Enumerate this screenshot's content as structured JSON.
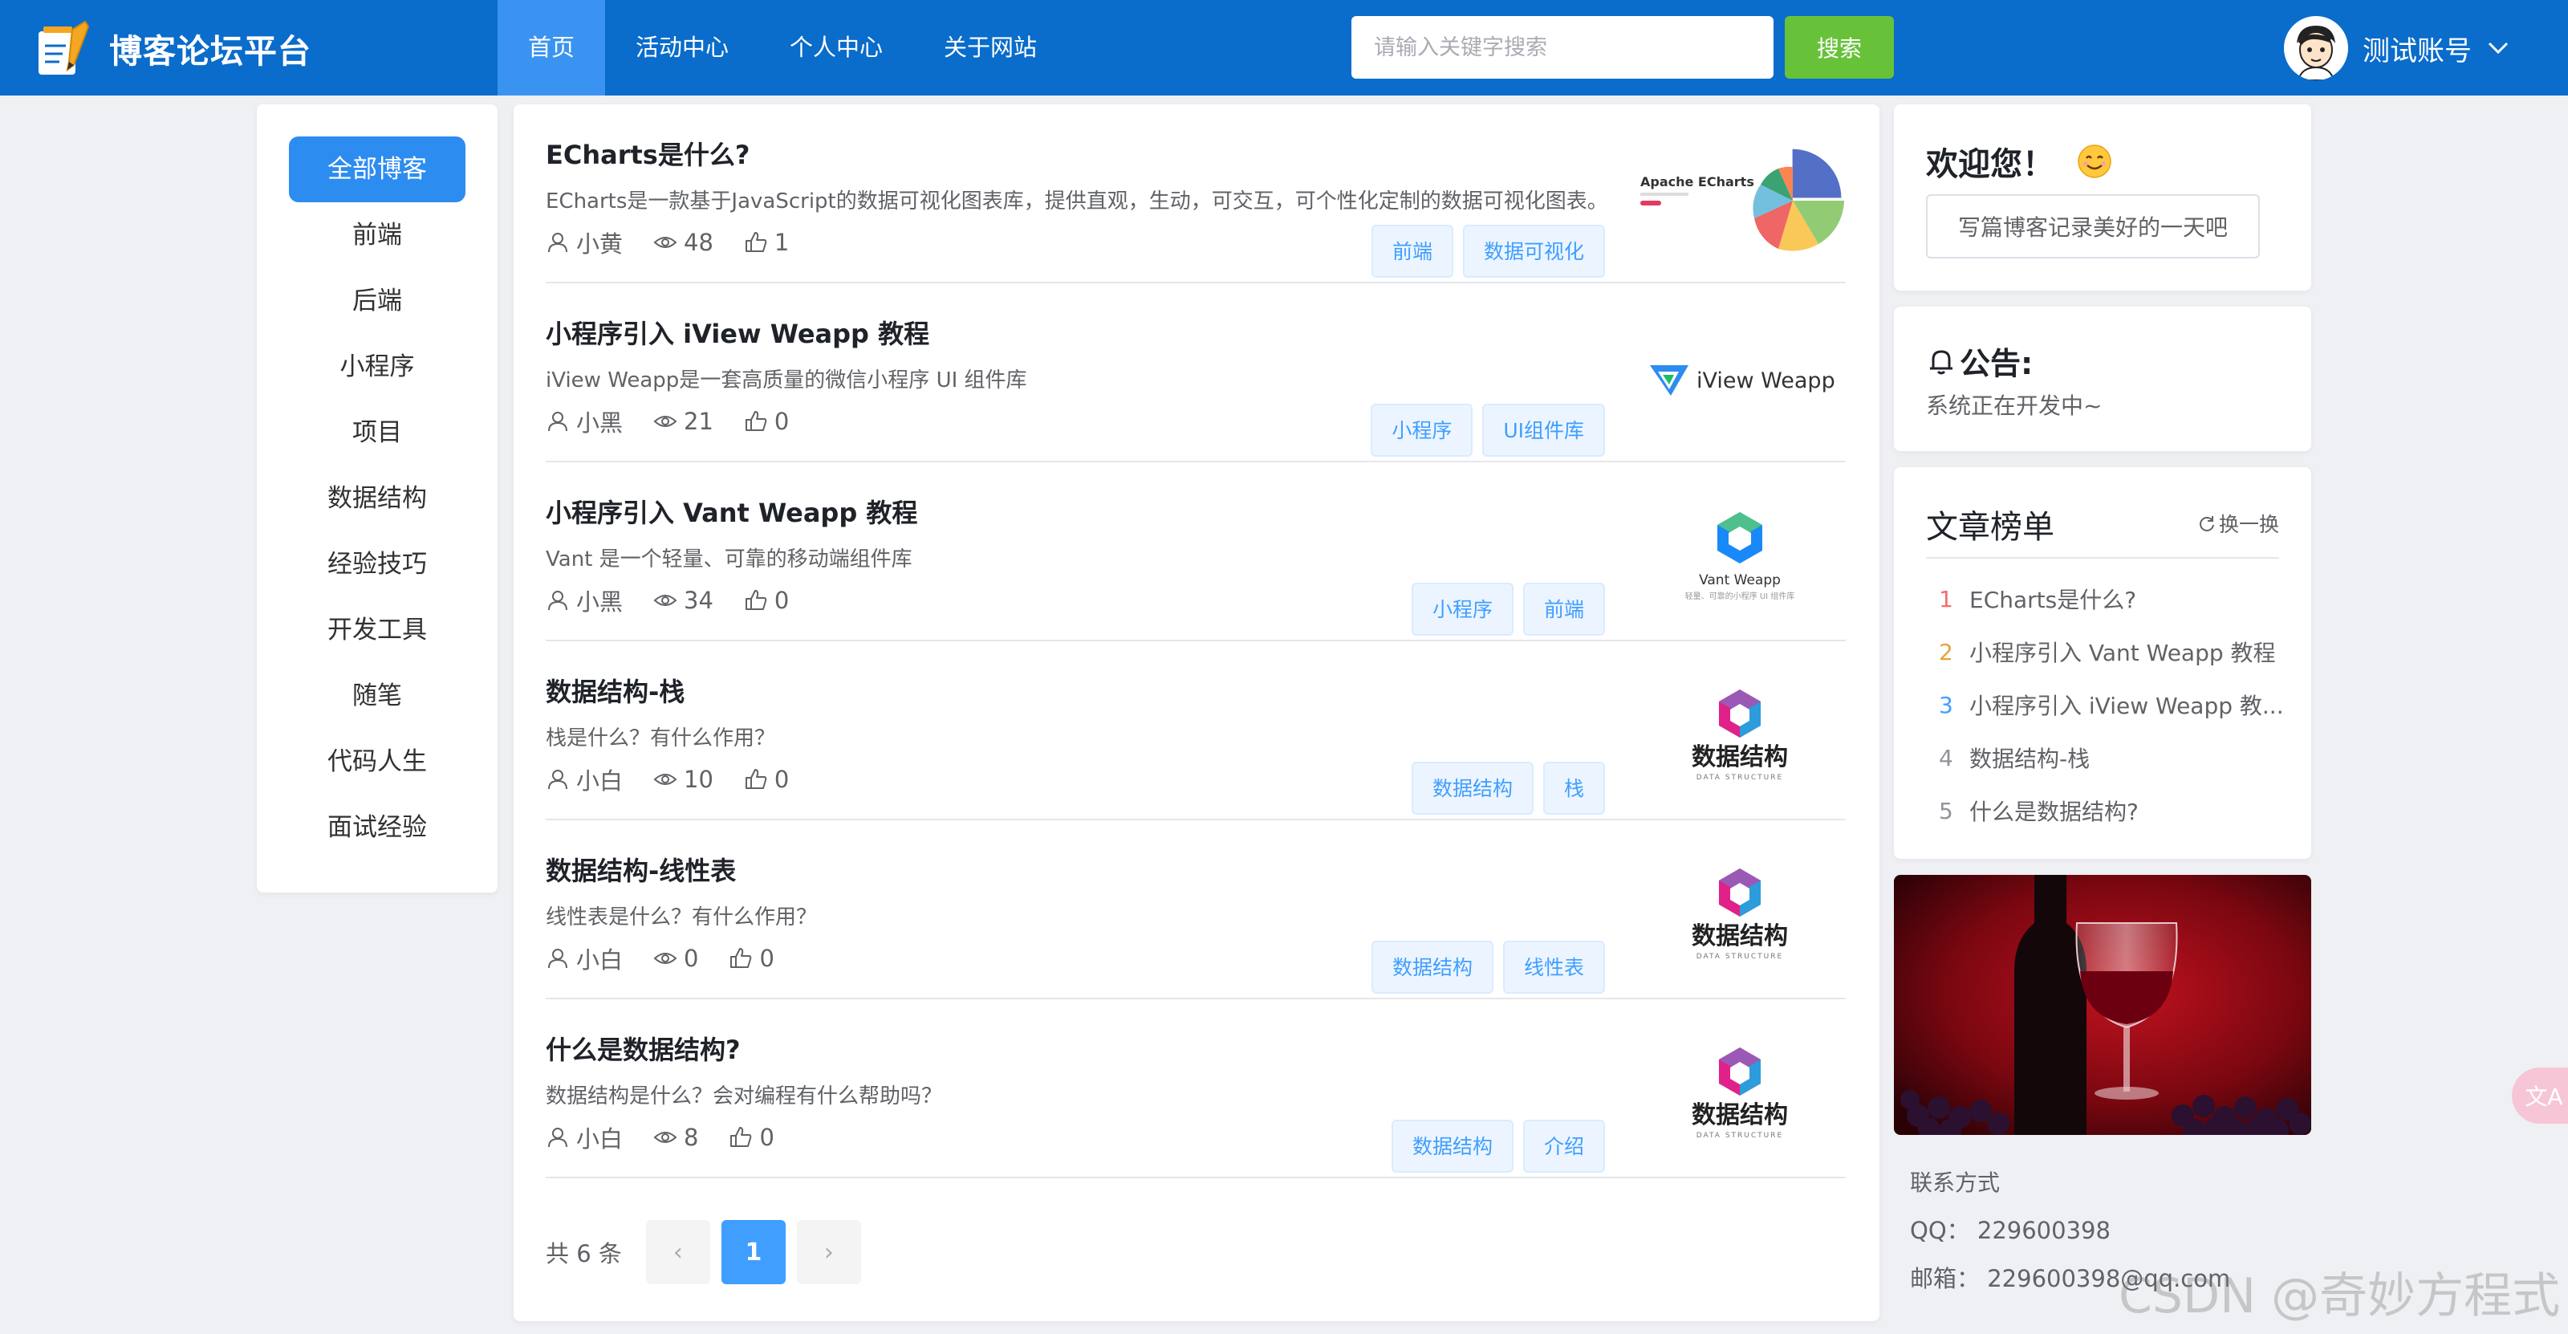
{
  "header": {
    "site_name": "博客论坛平台",
    "nav": [
      "首页",
      "活动中心",
      "个人中心",
      "关于网站"
    ],
    "search_placeholder": "请输入关键字搜索",
    "search_button": "搜索",
    "user_name": "测试账号"
  },
  "categories": [
    "全部博客",
    "前端",
    "后端",
    "小程序",
    "项目",
    "数据结构",
    "经验技巧",
    "开发工具",
    "随笔",
    "代码人生",
    "面试经验"
  ],
  "articles": [
    {
      "title": "ECharts是什么?",
      "desc": "ECharts是一款基于JavaScript的数据可视化图表库，提供直观，生动，可交互，可个性化定制的数据可视化图表。",
      "author": "小黄",
      "views": "48",
      "likes": "1",
      "tags": [
        "前端",
        "数据可视化"
      ],
      "thumb": "echarts"
    },
    {
      "title": "小程序引入 iView Weapp 教程",
      "desc": "iView Weapp是一套高质量的微信小程序 UI 组件库",
      "author": "小黑",
      "views": "21",
      "likes": "0",
      "tags": [
        "小程序",
        "UI组件库"
      ],
      "thumb": "iview"
    },
    {
      "title": "小程序引入 Vant Weapp 教程",
      "desc": "Vant 是一个轻量、可靠的移动端组件库",
      "author": "小黑",
      "views": "34",
      "likes": "0",
      "tags": [
        "小程序",
        "前端"
      ],
      "thumb": "vant"
    },
    {
      "title": "数据结构-栈",
      "desc": "栈是什么？有什么作用？",
      "author": "小白",
      "views": "10",
      "likes": "0",
      "tags": [
        "数据结构",
        "栈"
      ],
      "thumb": "ds"
    },
    {
      "title": "数据结构-线性表",
      "desc": "线性表是什么？有什么作用？",
      "author": "小白",
      "views": "0",
      "likes": "0",
      "tags": [
        "数据结构",
        "线性表"
      ],
      "thumb": "ds"
    },
    {
      "title": "什么是数据结构?",
      "desc": "数据结构是什么？会对编程有什么帮助吗？",
      "author": "小白",
      "views": "8",
      "likes": "0",
      "tags": [
        "数据结构",
        "介绍"
      ],
      "thumb": "ds"
    }
  ],
  "thumbs": {
    "echarts_label": "Apache ECharts",
    "iview_label": "iView Weapp",
    "vant_label": "Vant Weapp",
    "vant_sub": "轻量、可靠的小程序 UI 组件库",
    "ds_label": "数据结构",
    "ds_sub": "DATA STRUCTURE"
  },
  "pagination": {
    "total": "共 6 条",
    "current": "1",
    "prev": "‹",
    "next": "›"
  },
  "welcome": {
    "title": "欢迎您！",
    "button": "写篇博客记录美好的一天吧"
  },
  "notice": {
    "title": "公告:",
    "text": "系统正在开发中~"
  },
  "ranking": {
    "title": "文章榜单",
    "refresh": "换一换",
    "items": [
      {
        "num": "1",
        "text": "ECharts是什么?"
      },
      {
        "num": "2",
        "text": "小程序引入 Vant Weapp 教程"
      },
      {
        "num": "3",
        "text": "小程序引入 iView Weapp 教..."
      },
      {
        "num": "4",
        "text": "数据结构-栈"
      },
      {
        "num": "5",
        "text": "什么是数据结构?"
      }
    ],
    "num_colors": [
      "#f56c6c",
      "#e6a23c",
      "#409eff",
      "#909399",
      "#909399"
    ]
  },
  "contact": {
    "title": "联系方式",
    "qq": "QQ：  229600398",
    "email": "邮箱：  229600398@qq.com"
  },
  "watermark": "CSDN @奇妙方程式",
  "translate_label": "文A",
  "colors": {
    "header": "#0a6ccb",
    "nav_active": "#3a93f0",
    "accent": "#2d8cf0",
    "search": "#67c23a"
  }
}
